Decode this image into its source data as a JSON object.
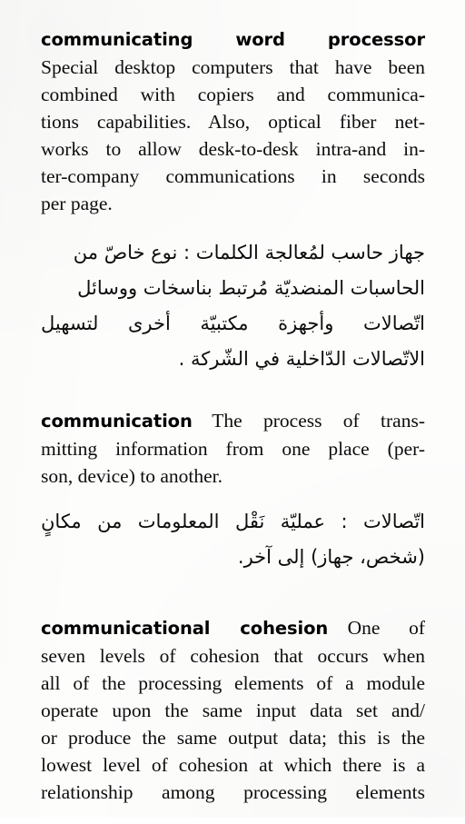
{
  "page": {
    "background_color": "#fdfdfc",
    "text_color": "#0d0d0d",
    "type": "bilingual-dictionary-page"
  },
  "entries": [
    {
      "headword": "communicating word processor",
      "english_lines": [
        "Special desktop computers that have been",
        "combined with copiers and communica-",
        "tions capabilities. Also, optical fiber net-",
        "works to allow desk-to-desk intra-and in-",
        "ter-company communications in seconds",
        "per page."
      ],
      "english_definition": "Special desktop computers that have been combined with copiers and communications capabilities. Also, optical fiber networks to allow desk-to-desk intra-and inter-company communications in seconds per page.",
      "arabic_lines": [
        "جهاز حاسب لمُعالجة الكلمات : نوع خاصّ من",
        "الحاسبات المنضديّة مُرتبط بناسخات ووسائل",
        "اتّصالات وأجهزة مكتبيّة أخرى لتسهيل",
        "الاتّصالات الدّاخلية في الشّركة ."
      ],
      "arabic_definition": "جهاز حاسب لمُعالجة الكلمات : نوع خاصّ من الحاسبات المنضديّة مُرتبط بناسخات ووسائل اتّصالات وأجهزة مكتبيّة أخرى لتسهيل الاتّصالات الدّاخلية في الشّركة ."
    },
    {
      "headword": "communication",
      "english_lines": [
        "The process of trans-",
        "mitting information from one place (per-",
        "son, device) to another."
      ],
      "english_definition": "The process of transmitting information from one place (person, device) to another.",
      "arabic_lines": [
        "اتّصالات : عمليّة نَقْل المعلومات من مكانٍ",
        "(شخص، جهاز) إلى آخر."
      ],
      "arabic_definition": "اتّصالات : عمليّة نَقْل المعلومات من مكانٍ (شخص، جهاز) إلى آخر."
    },
    {
      "headword": "communicational cohesion",
      "english_lines": [
        "One of",
        "seven levels of cohesion that occurs when",
        "all of the processing elements of a module",
        "operate upon the same input data set and/",
        "or produce the same output data; this is the",
        "lowest level of cohesion at which there is a",
        "relationship among processing elements"
      ],
      "english_definition": "One of seven levels of cohesion that occurs when all of the processing elements of a module operate upon the same input data set and/or produce the same output data; this is the lowest level of cohesion at which there is a relationship among processing elements"
    }
  ]
}
